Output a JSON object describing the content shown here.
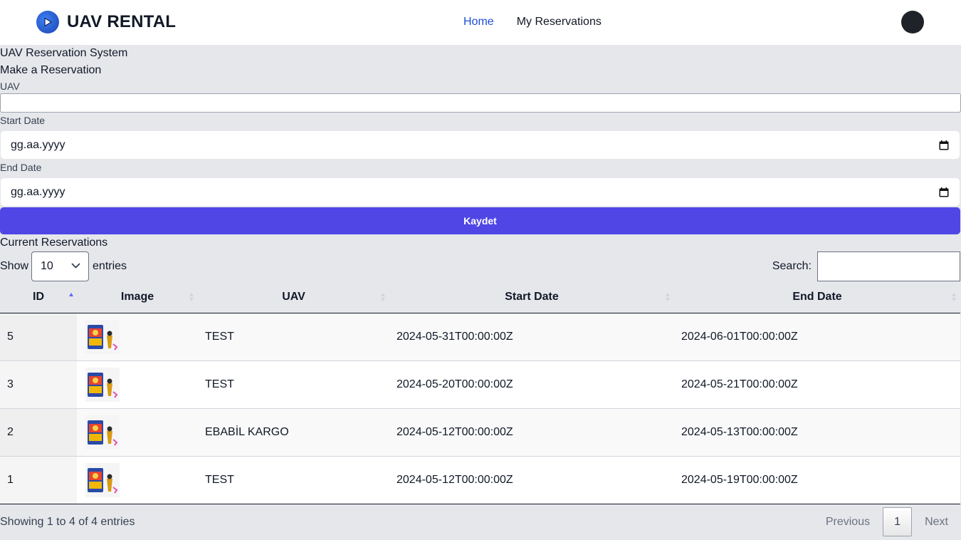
{
  "nav": {
    "brand": "UAV RENTAL",
    "links": [
      "Home",
      "My Reservations"
    ],
    "active_link": "Home"
  },
  "page": {
    "system_title": "UAV Reservation System",
    "form_title": "Make a Reservation"
  },
  "form": {
    "uav_label": "UAV",
    "uav_value": "",
    "start_label": "Start Date",
    "start_placeholder": "gg.aa.yyyy",
    "end_label": "End Date",
    "end_placeholder": "gg.aa.yyyy",
    "submit_label": "Kaydet"
  },
  "reservations": {
    "title": "Current Reservations",
    "show_label": "Show",
    "page_size": "10",
    "entries_label": "entries",
    "search_label": "Search:",
    "columns": [
      "ID",
      "Image",
      "UAV",
      "Start Date",
      "End Date"
    ],
    "sorted_column": "ID",
    "sort_direction": "ascending",
    "rows": [
      {
        "id": "5",
        "uav": "TEST",
        "start": "2024-05-31T00:00:00Z",
        "end": "2024-06-01T00:00:00Z"
      },
      {
        "id": "3",
        "uav": "TEST",
        "start": "2024-05-20T00:00:00Z",
        "end": "2024-05-21T00:00:00Z"
      },
      {
        "id": "2",
        "uav": "EBABİL KARGO",
        "start": "2024-05-12T00:00:00Z",
        "end": "2024-05-13T00:00:00Z"
      },
      {
        "id": "1",
        "uav": "TEST",
        "start": "2024-05-12T00:00:00Z",
        "end": "2024-05-19T00:00:00Z"
      }
    ],
    "info": "Showing 1 to 4 of 4 entries",
    "pagination": {
      "previous": "Previous",
      "current": "1",
      "next": "Next"
    }
  },
  "colors": {
    "accent": "#4f46e5",
    "active_link": "#1d4ed8",
    "page_background": "#e5e7eb"
  },
  "icons": [
    "play-logo-icon",
    "avatar",
    "calendar-icon",
    "chevron-down-icon",
    "sort-icon",
    "uav-thumbnail"
  ]
}
